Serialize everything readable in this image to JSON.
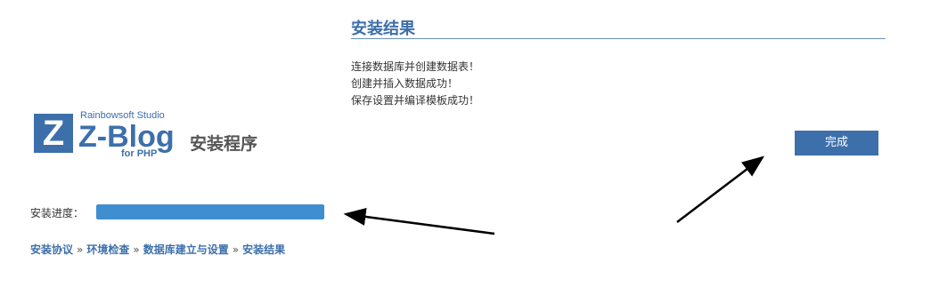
{
  "logo": {
    "mark": "Z",
    "studio": "Rainbowsoft Studio",
    "name": "Z-Blog",
    "platform": "for PHP",
    "suffix": "安装程序"
  },
  "progress": {
    "label": "安装进度：",
    "percent": 100,
    "fill_color": "#3f8ed0"
  },
  "breadcrumb": {
    "steps": [
      "安装协议",
      "环境检查",
      "数据库建立与设置",
      "安装结果"
    ],
    "separator": "»"
  },
  "result": {
    "title": "安装结果",
    "messages": [
      "连接数据库并创建数据表！",
      "创建并插入数据成功！",
      "保存设置并编译模板成功！"
    ],
    "finish_label": "完成"
  },
  "colors": {
    "accent": "#3d6fab",
    "annotation_arrow": "#000000"
  }
}
